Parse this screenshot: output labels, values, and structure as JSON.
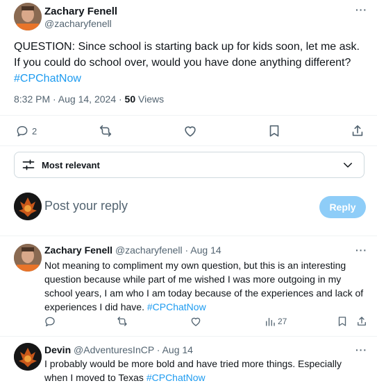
{
  "main_post": {
    "author_name": "Zachary Fenell",
    "handle": "@zacharyfenell",
    "text": "QUESTION: Since school is starting back up for kids soon, let me ask. If you could do school over, would you have done anything different?",
    "hashtag": "#CPChatNow",
    "time": "8:32 PM · Aug 14, 2024 · ",
    "views_count": "50",
    "views_label": " Views",
    "reply_count": "2"
  },
  "sort": {
    "label": "Most relevant"
  },
  "composer": {
    "placeholder": "Post your reply",
    "reply_button": "Reply"
  },
  "replies": [
    {
      "author_name": "Zachary Fenell",
      "meta": "@zacharyfenell · Aug 14",
      "text": "Not meaning to compliment my own question, but this is an interesting question because while part of me wished I was more outgoing in my school years, I am who I am today because of the experiences and lack of experiences I did have.",
      "hashtag": "#CPChatNow",
      "views": "27"
    },
    {
      "author_name": "Devin",
      "meta": "@AdventuresInCP · Aug 14",
      "text": "I probably would be more bold and have tried more things. Especially when I moved to Texas",
      "hashtag": "#CPChatNow"
    }
  ],
  "more_glyph": "···",
  "colors": {
    "accent": "#1d9bf0",
    "muted": "#536471",
    "text": "#0f1419",
    "reply_button_bg": "#8ecdf8"
  }
}
